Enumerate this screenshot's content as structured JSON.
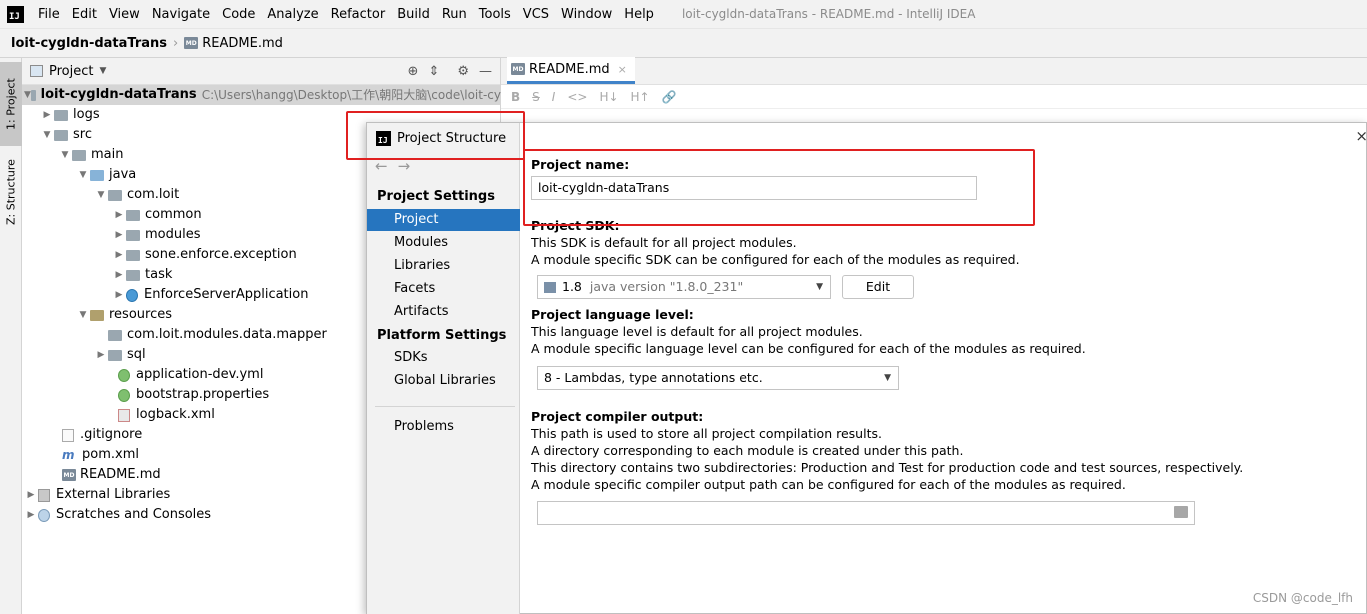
{
  "menubar": {
    "items": [
      "File",
      "Edit",
      "View",
      "Navigate",
      "Code",
      "Analyze",
      "Refactor",
      "Build",
      "Run",
      "Tools",
      "VCS",
      "Window",
      "Help"
    ],
    "window_title": "loit-cygldn-dataTrans - README.md - IntelliJ IDEA",
    "logo_text": "IJ"
  },
  "breadcrumb": {
    "project": "loit-cygldn-dataTrans",
    "file": "README.md",
    "file_icon_text": "MD"
  },
  "tool_strip": {
    "project_tab": "1: Project",
    "structure_tab": "Z: Structure"
  },
  "project_panel": {
    "title": "Project",
    "tree": [
      {
        "label": "loit-cygldn-dataTrans",
        "hint": "C:\\Users\\hangg\\Desktop\\工作\\朝阳大脑\\code\\loit-cy"
      },
      {
        "label": "logs"
      },
      {
        "label": "src"
      },
      {
        "label": "main"
      },
      {
        "label": "java"
      },
      {
        "label": "com.loit"
      },
      {
        "label": "common"
      },
      {
        "label": "modules"
      },
      {
        "label": "sone.enforce.exception"
      },
      {
        "label": "task"
      },
      {
        "label": "EnforceServerApplication"
      },
      {
        "label": "resources"
      },
      {
        "label": "com.loit.modules.data.mapper"
      },
      {
        "label": "sql"
      },
      {
        "label": "application-dev.yml"
      },
      {
        "label": "bootstrap.properties"
      },
      {
        "label": "logback.xml"
      },
      {
        "label": ".gitignore"
      },
      {
        "label": "pom.xml"
      },
      {
        "label": "README.md"
      },
      {
        "label": "External Libraries"
      },
      {
        "label": "Scratches and Consoles"
      }
    ]
  },
  "editor": {
    "tab_label": "README.md",
    "tab_close": "×",
    "toolbar": [
      "B",
      "S",
      "I",
      "<>",
      "H↓",
      "H↑",
      "🔗"
    ]
  },
  "dialog": {
    "title": "Project Structure",
    "close": "×",
    "nav_back": "←",
    "nav_fwd": "→",
    "nav": {
      "project_settings_head": "Project Settings",
      "project_settings": [
        "Project",
        "Modules",
        "Libraries",
        "Facets",
        "Artifacts"
      ],
      "platform_settings_head": "Platform Settings",
      "platform_settings": [
        "SDKs",
        "Global Libraries"
      ],
      "problems": "Problems"
    },
    "content": {
      "name_label": "Project name:",
      "name_value": "loit-cygldn-dataTrans",
      "sdk_label": "Project SDK:",
      "sdk_desc1": "This SDK is default for all project modules.",
      "sdk_desc2": "A module specific SDK can be configured for each of the modules as required.",
      "sdk_value": "1.8",
      "sdk_version": "java version \"1.8.0_231\"",
      "sdk_edit": "Edit",
      "lang_label": "Project language level:",
      "lang_desc1": "This language level is default for all project modules.",
      "lang_desc2": "A module specific language level can be configured for each of the modules as required.",
      "lang_value": "8 - Lambdas, type annotations etc.",
      "output_label": "Project compiler output:",
      "output_desc1": "This path is used to store all project compilation results.",
      "output_desc2": "A directory corresponding to each module is created under this path.",
      "output_desc3": "This directory contains two subdirectories: Production and Test for production code and test sources, respectively.",
      "output_desc4": "A module specific compiler output path can be configured for each of the modules as required.",
      "output_value": ""
    }
  },
  "watermark": "CSDN @code_lfh",
  "colors": {
    "selection": "#2675bf",
    "highlight_box": "#e02020"
  }
}
